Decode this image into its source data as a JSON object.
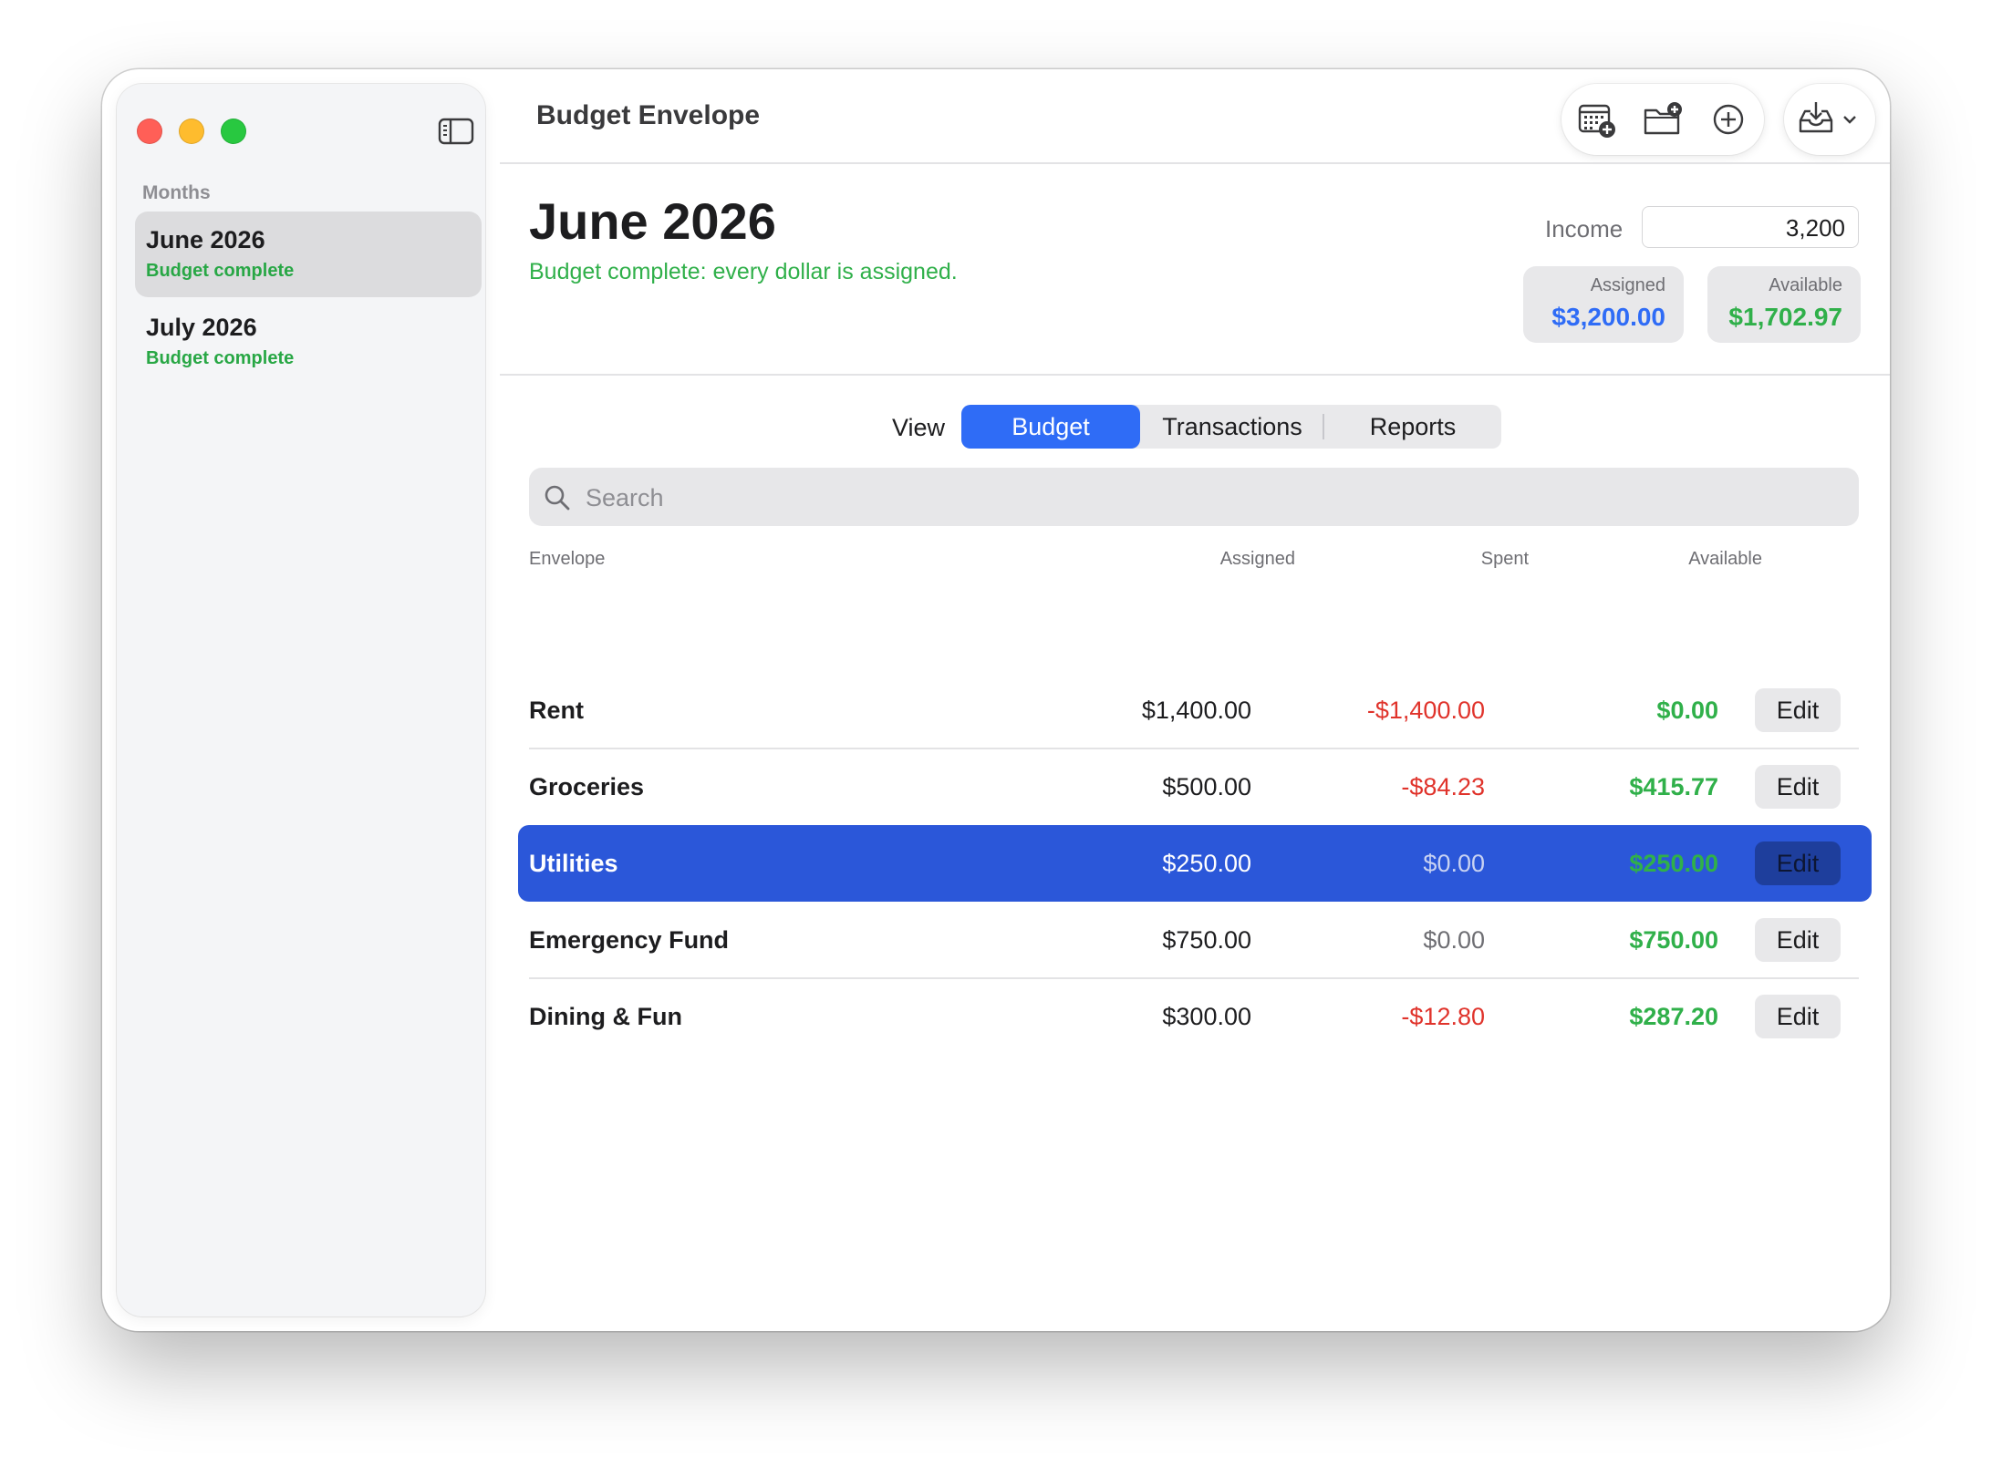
{
  "window": {
    "title": "Budget Envelope"
  },
  "sidebar": {
    "section_label": "Months",
    "months": [
      {
        "title": "June 2026",
        "status": "Budget complete",
        "selected": true
      },
      {
        "title": "July 2026",
        "status": "Budget complete",
        "selected": false
      }
    ]
  },
  "toolbar": {
    "icons": [
      "calendar-add-icon",
      "folder-add-icon",
      "plus-circle-icon",
      "inbox-download-icon"
    ]
  },
  "header": {
    "month": "June 2026",
    "status": "Budget complete: every dollar is assigned.",
    "income_label": "Income",
    "income_value": "3,200",
    "assigned_label": "Assigned",
    "assigned_value": "$3,200.00",
    "available_label": "Available",
    "available_value": "$1,702.97"
  },
  "view": {
    "label": "View",
    "tabs": [
      "Budget",
      "Transactions",
      "Reports"
    ],
    "active": "Budget"
  },
  "search": {
    "placeholder": "Search"
  },
  "table": {
    "columns": [
      "Envelope",
      "Assigned",
      "Spent",
      "Available"
    ],
    "rows": [
      {
        "name": "Rent",
        "assigned": "$1,400.00",
        "spent": "-$1,400.00",
        "available": "$0.00",
        "action": "Edit"
      },
      {
        "name": "Groceries",
        "assigned": "$500.00",
        "spent": "-$84.23",
        "available": "$415.77",
        "action": "Edit"
      },
      {
        "name": "Utilities",
        "assigned": "$250.00",
        "spent": "$0.00",
        "available": "$250.00",
        "action": "Edit",
        "selected": true
      },
      {
        "name": "Emergency Fund",
        "assigned": "$750.00",
        "spent": "$0.00",
        "available": "$750.00",
        "action": "Edit"
      },
      {
        "name": "Dining & Fun",
        "assigned": "$300.00",
        "spent": "-$12.80",
        "available": "$287.20",
        "action": "Edit"
      }
    ]
  },
  "colors": {
    "accent": "#2f6cf6",
    "selected_row": "#2b57d9",
    "positive": "#30b04a",
    "negative": "#e0332b",
    "assigned_value": "#2f6cf6"
  }
}
